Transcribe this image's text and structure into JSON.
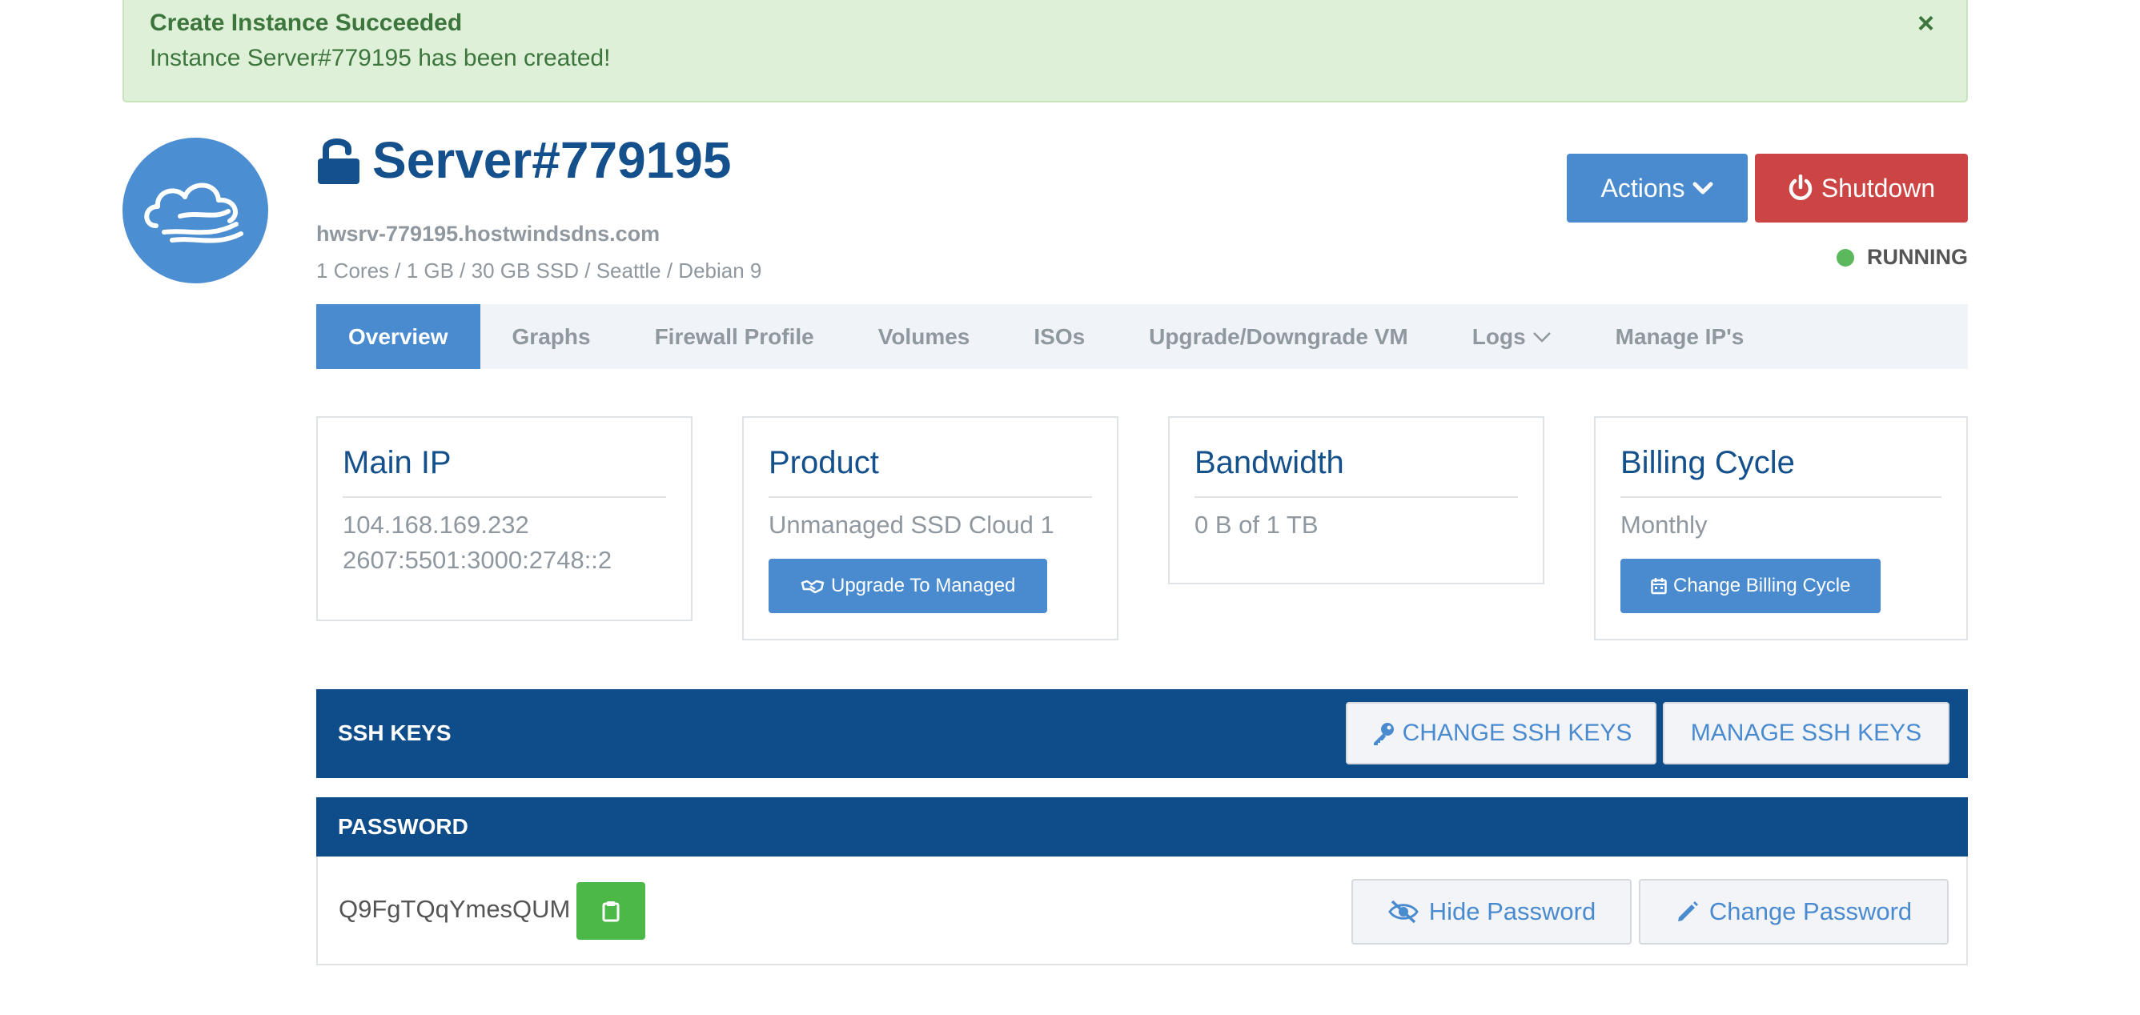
{
  "alert": {
    "title": "Create Instance Succeeded",
    "message": "Instance Server#779195 has been created!",
    "close": "×"
  },
  "server": {
    "name": "Server#779195",
    "hostname": "hwsrv-779195.hostwindsdns.com",
    "specs": "1 Cores / 1 GB / 30 GB SSD / Seattle / Debian 9",
    "status": "RUNNING"
  },
  "buttons": {
    "actions": "Actions",
    "shutdown": "Shutdown"
  },
  "tabs": [
    {
      "label": "Overview",
      "active": true
    },
    {
      "label": "Graphs"
    },
    {
      "label": "Firewall Profile"
    },
    {
      "label": "Volumes"
    },
    {
      "label": "ISOs"
    },
    {
      "label": "Upgrade/Downgrade VM"
    },
    {
      "label": "Logs"
    },
    {
      "label": "Manage IP's"
    }
  ],
  "cards": {
    "main_ip": {
      "title": "Main IP",
      "ipv4": "104.168.169.232",
      "ipv6": "2607:5501:3000:2748::2"
    },
    "product": {
      "title": "Product",
      "value": "Unmanaged SSD Cloud 1",
      "button": "Upgrade To Managed"
    },
    "bandwidth": {
      "title": "Bandwidth",
      "value": "0 B of 1 TB"
    },
    "billing": {
      "title": "Billing Cycle",
      "value": "Monthly",
      "button": "Change Billing Cycle"
    }
  },
  "ssh": {
    "title": "SSH KEYS",
    "change_label": "CHANGE SSH KEYS",
    "manage_label": "MANAGE SSH KEYS"
  },
  "password": {
    "title": "PASSWORD",
    "value": "Q9FgTQqYmesQUM",
    "hide_label": "Hide Password",
    "change_label": "Change Password"
  },
  "colors": {
    "accent": "#4a8bd0",
    "navy": "#0f4c8a",
    "danger": "#cc4444",
    "success": "#5cb85c",
    "alert_bg": "#dff0d8"
  }
}
